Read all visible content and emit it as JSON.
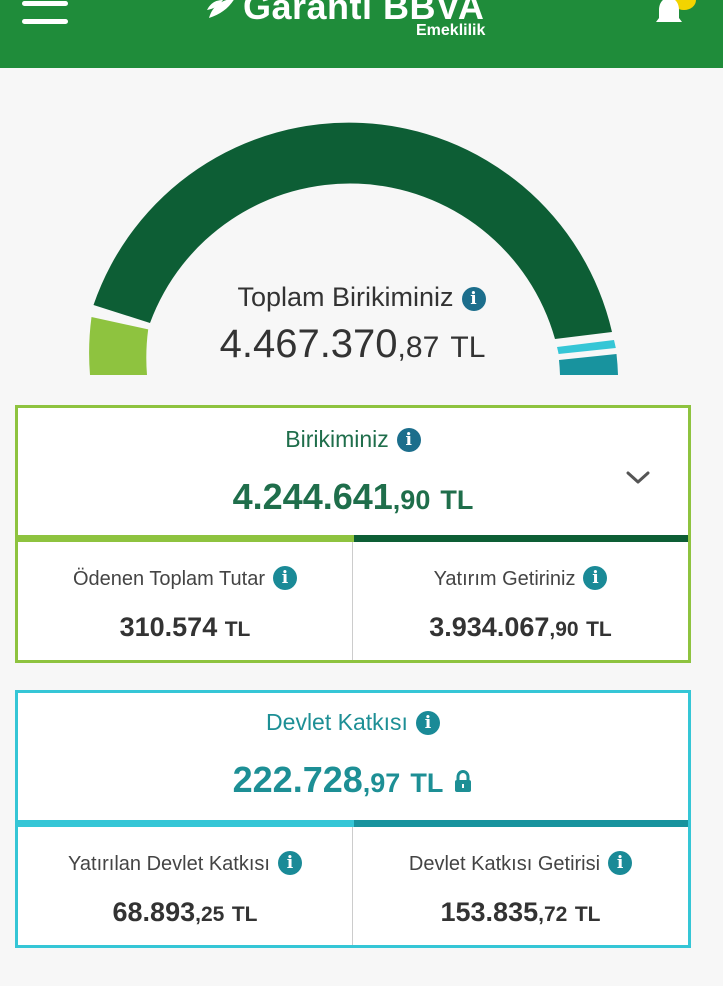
{
  "header": {
    "brand": "Garanti BBVA",
    "brand_sub": "Emeklilik"
  },
  "total": {
    "label": "Toplam Birikiminiz",
    "amount_main": "4.467.370",
    "amount_decimal": ",87",
    "currency": "TL"
  },
  "savings": {
    "label": "Birikiminiz",
    "amount_main": "4.244.641",
    "amount_decimal": ",90",
    "currency": "TL",
    "paid": {
      "label": "Ödenen Toplam Tutar",
      "amount_main": "310.574",
      "amount_decimal": "",
      "currency": "TL"
    },
    "return": {
      "label": "Yatırım Getiriniz",
      "amount_main": "3.934.067",
      "amount_decimal": ",90",
      "currency": "TL"
    }
  },
  "state_contribution": {
    "label": "Devlet Katkısı",
    "amount_main": "222.728",
    "amount_decimal": ",97",
    "currency": "TL",
    "deposited": {
      "label": "Yatırılan Devlet Katkısı",
      "amount_main": "68.893",
      "amount_decimal": ",25",
      "currency": "TL"
    },
    "return": {
      "label": "Devlet Katkısı Getirisi",
      "amount_main": "153.835",
      "amount_decimal": ",72",
      "currency": "TL"
    }
  },
  "colors": {
    "header": "#1f8c3a",
    "gauge_dark": "#0d5e35",
    "gauge_light": "#8ec33f",
    "gauge_cyan": "#35c6d6",
    "gauge_teal": "#18939e"
  },
  "icons": {
    "menu": "hamburger-icon",
    "notification": "bell-icon",
    "info": "info-icon",
    "expand": "chevron-down-icon",
    "locked": "lock-icon"
  }
}
